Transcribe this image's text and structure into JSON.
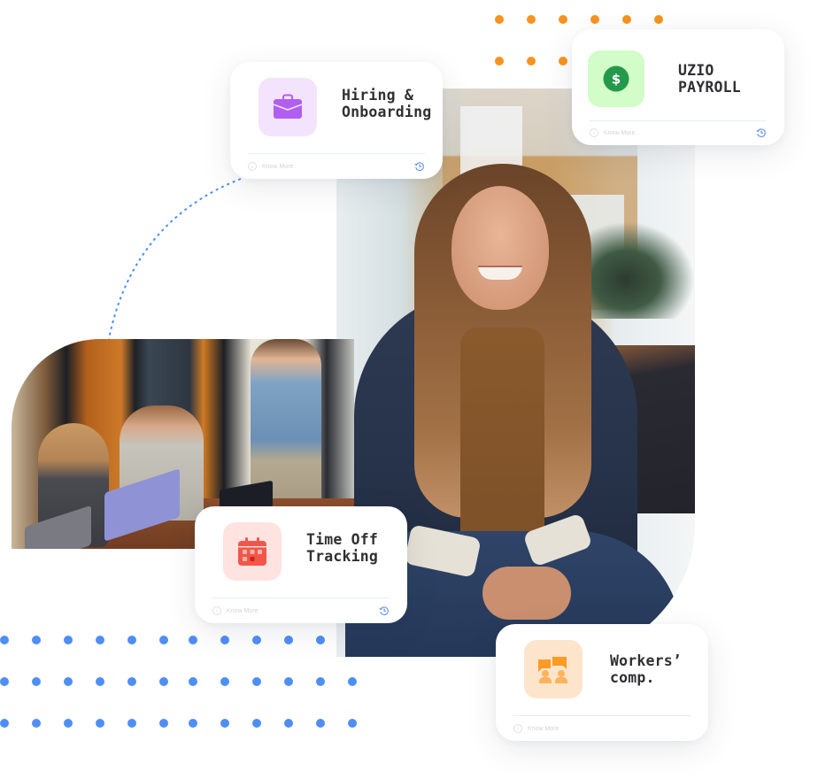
{
  "colors": {
    "orange_dot": "#f7931e",
    "blue_dot": "#4f8ef7",
    "connector": "#4f8ef7",
    "title_text": "#2f3033",
    "footer_text": "#d4d4d4",
    "history_icon": "#5b8fe8"
  },
  "images": {
    "main_photo": "Smiling woman with long hair in navy blazer sitting in an office",
    "group_photo": "Three colleagues in a meeting room, woman standing presenting to two seated people with laptops"
  },
  "cards": [
    {
      "id": "hiring",
      "title_line1": "Hiring &",
      "title_line2": "Onboarding",
      "icon": "briefcase-icon",
      "tile_color": "#f4e3fd",
      "icon_color": "#b05ff0",
      "footer_label": "Know More",
      "footer_icon": "history-icon"
    },
    {
      "id": "payroll",
      "title_line1": "UZIO",
      "title_line2": "PAYROLL",
      "icon": "dollar-icon",
      "tile_color": "#d2fcc8",
      "icon_color": "#24994b",
      "footer_label": "Know More",
      "footer_icon": "history-icon"
    },
    {
      "id": "timeoff",
      "title_line1": "Time Off",
      "title_line2": "Tracking",
      "icon": "calendar-icon",
      "tile_color": "#ffe3e0",
      "icon_color": "#f2564a",
      "footer_label": "Know More",
      "footer_icon": "history-icon"
    },
    {
      "id": "workers",
      "title_line1": "Workers’",
      "title_line2": "comp.",
      "icon": "team-chat-icon",
      "tile_color": "#fde5cc",
      "icon_color": "#ff9a24",
      "footer_label": "Know More",
      "footer_icon": null
    }
  ]
}
